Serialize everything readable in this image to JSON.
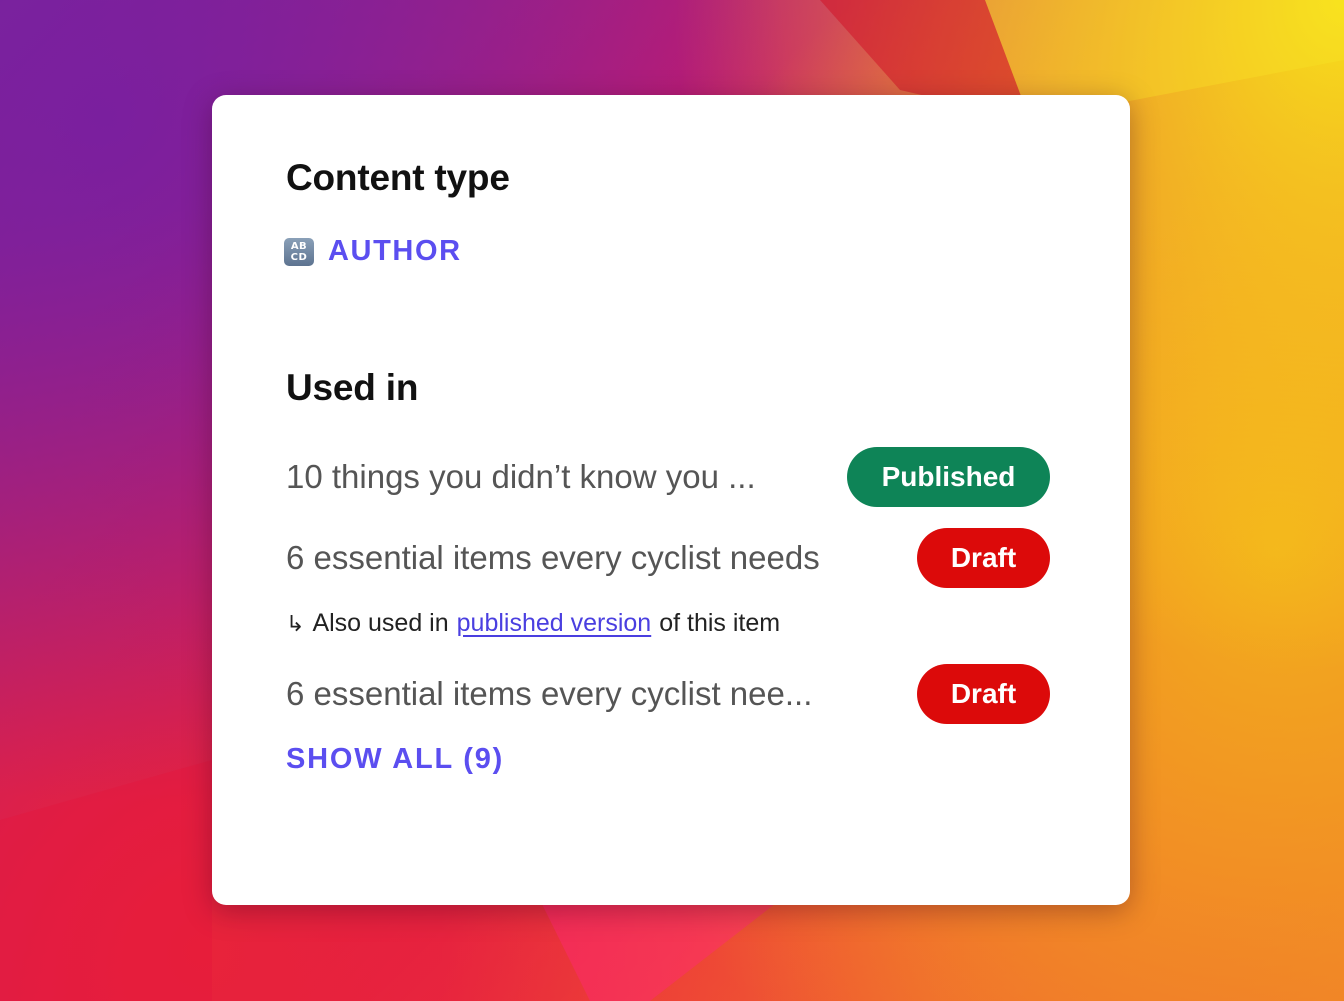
{
  "colors": {
    "accent": "#5b4ef0",
    "published": "#0e8457",
    "draft": "#dc0a0a",
    "heading": "#111111",
    "item_text": "#555555"
  },
  "content_type": {
    "heading": "Content type",
    "icon": "abcd-input-symbol-icon",
    "icon_glyph_top": "AB",
    "icon_glyph_bottom": "CD",
    "value": "AUTHOR"
  },
  "used_in": {
    "heading": "Used in",
    "items": [
      {
        "title": "10 things you didn’t know you ...",
        "status": "Published"
      },
      {
        "title": "6 essential items every cyclist needs",
        "status": "Draft"
      },
      {
        "title": "6 essential items every cyclist nee...",
        "status": "Draft"
      }
    ],
    "also_used": {
      "arrow": "↳",
      "prefix": "Also used in",
      "link": "published version",
      "suffix": "of this item"
    },
    "show_all": "SHOW ALL (9)"
  }
}
